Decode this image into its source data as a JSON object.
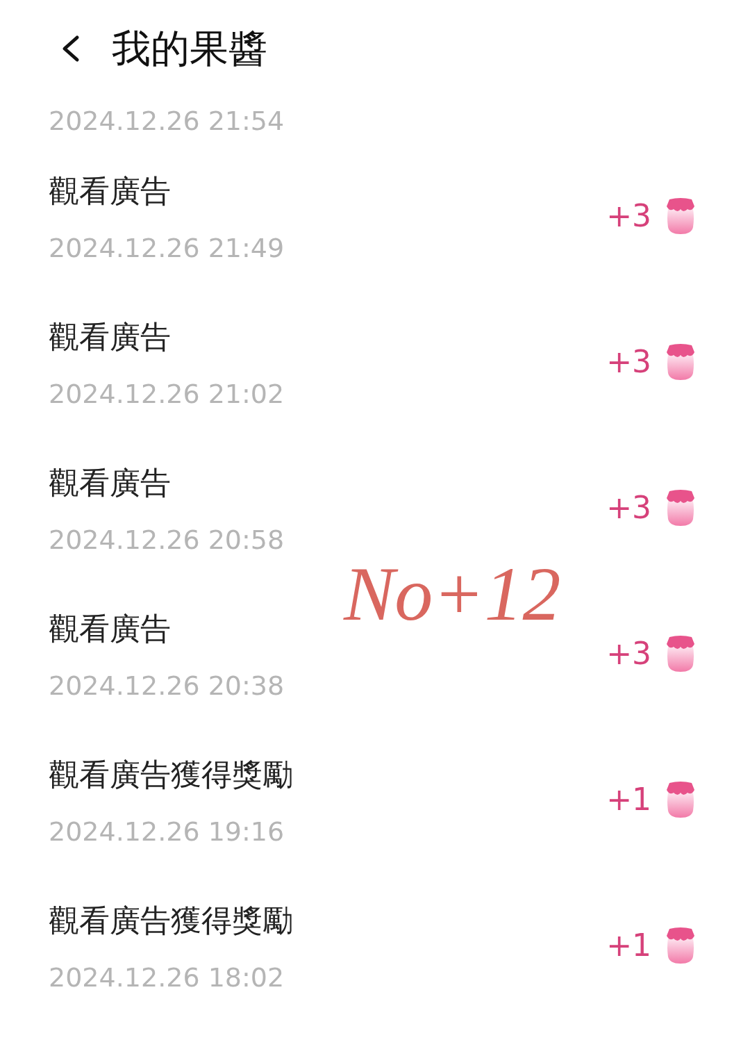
{
  "header": {
    "title": "我的果醬"
  },
  "partial_entry": {
    "date": "2024.12.26 21:54"
  },
  "entries": [
    {
      "title": "觀看廣告",
      "date": "2024.12.26 21:49",
      "amount": "+3"
    },
    {
      "title": "觀看廣告",
      "date": "2024.12.26 21:02",
      "amount": "+3"
    },
    {
      "title": "觀看廣告",
      "date": "2024.12.26 20:58",
      "amount": "+3"
    },
    {
      "title": "觀看廣告",
      "date": "2024.12.26 20:38",
      "amount": "+3"
    },
    {
      "title": "觀看廣告獲得獎勵",
      "date": "2024.12.26 19:16",
      "amount": "+1"
    },
    {
      "title": "觀看廣告獲得獎勵",
      "date": "2024.12.26 18:02",
      "amount": "+1"
    }
  ],
  "annotation": {
    "text": "No+12"
  }
}
